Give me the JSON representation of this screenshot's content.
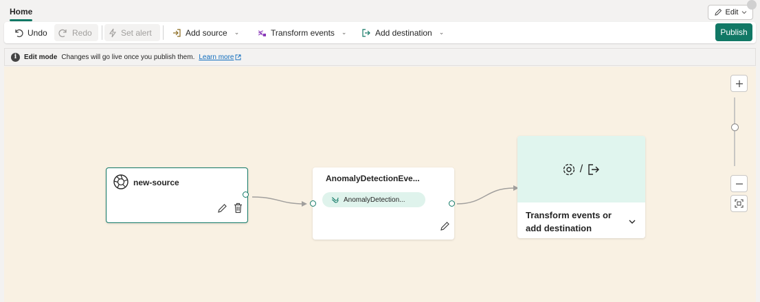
{
  "tabs": {
    "home_label": "Home"
  },
  "header": {
    "edit_label": "Edit"
  },
  "toolbar": {
    "undo_label": "Undo",
    "redo_label": "Redo",
    "set_alert_label": "Set alert",
    "add_source_label": "Add source",
    "transform_events_label": "Transform events",
    "add_destination_label": "Add destination",
    "publish_label": "Publish"
  },
  "infobar": {
    "title": "Edit mode",
    "message": "Changes will go live once you publish them.",
    "link_label": "Learn more"
  },
  "canvas": {
    "source_node": {
      "title": "new-source",
      "icon": "source-aperture-icon"
    },
    "stream_node": {
      "title": "AnomalyDetectionEve...",
      "pill_label": "AnomalyDetection..."
    },
    "destination_node": {
      "separator": "/",
      "label": "Transform events or add destination"
    }
  },
  "colors": {
    "accent": "#117865",
    "canvas_bg": "#f9f1e3",
    "destination_bg": "#e0f5ee",
    "pill_bg": "#dff3ec"
  }
}
